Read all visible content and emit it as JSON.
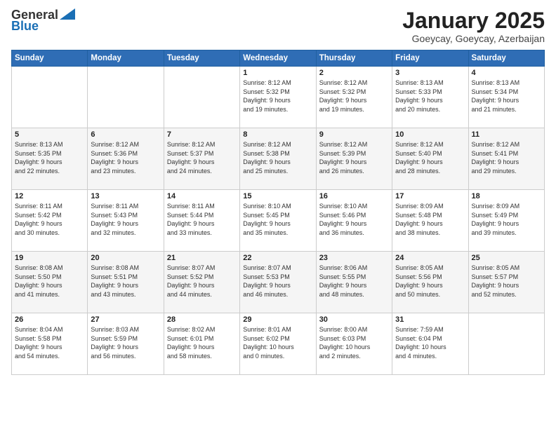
{
  "logo": {
    "general": "General",
    "blue": "Blue"
  },
  "header": {
    "month": "January 2025",
    "location": "Goeycay, Goeycay, Azerbaijan"
  },
  "weekdays": [
    "Sunday",
    "Monday",
    "Tuesday",
    "Wednesday",
    "Thursday",
    "Friday",
    "Saturday"
  ],
  "weeks": [
    [
      {
        "day": "",
        "info": ""
      },
      {
        "day": "",
        "info": ""
      },
      {
        "day": "",
        "info": ""
      },
      {
        "day": "1",
        "info": "Sunrise: 8:12 AM\nSunset: 5:32 PM\nDaylight: 9 hours\nand 19 minutes."
      },
      {
        "day": "2",
        "info": "Sunrise: 8:12 AM\nSunset: 5:32 PM\nDaylight: 9 hours\nand 19 minutes."
      },
      {
        "day": "3",
        "info": "Sunrise: 8:13 AM\nSunset: 5:33 PM\nDaylight: 9 hours\nand 20 minutes."
      },
      {
        "day": "4",
        "info": "Sunrise: 8:13 AM\nSunset: 5:34 PM\nDaylight: 9 hours\nand 21 minutes."
      }
    ],
    [
      {
        "day": "5",
        "info": "Sunrise: 8:13 AM\nSunset: 5:35 PM\nDaylight: 9 hours\nand 22 minutes."
      },
      {
        "day": "6",
        "info": "Sunrise: 8:12 AM\nSunset: 5:36 PM\nDaylight: 9 hours\nand 23 minutes."
      },
      {
        "day": "7",
        "info": "Sunrise: 8:12 AM\nSunset: 5:37 PM\nDaylight: 9 hours\nand 24 minutes."
      },
      {
        "day": "8",
        "info": "Sunrise: 8:12 AM\nSunset: 5:38 PM\nDaylight: 9 hours\nand 25 minutes."
      },
      {
        "day": "9",
        "info": "Sunrise: 8:12 AM\nSunset: 5:39 PM\nDaylight: 9 hours\nand 26 minutes."
      },
      {
        "day": "10",
        "info": "Sunrise: 8:12 AM\nSunset: 5:40 PM\nDaylight: 9 hours\nand 28 minutes."
      },
      {
        "day": "11",
        "info": "Sunrise: 8:12 AM\nSunset: 5:41 PM\nDaylight: 9 hours\nand 29 minutes."
      }
    ],
    [
      {
        "day": "12",
        "info": "Sunrise: 8:11 AM\nSunset: 5:42 PM\nDaylight: 9 hours\nand 30 minutes."
      },
      {
        "day": "13",
        "info": "Sunrise: 8:11 AM\nSunset: 5:43 PM\nDaylight: 9 hours\nand 32 minutes."
      },
      {
        "day": "14",
        "info": "Sunrise: 8:11 AM\nSunset: 5:44 PM\nDaylight: 9 hours\nand 33 minutes."
      },
      {
        "day": "15",
        "info": "Sunrise: 8:10 AM\nSunset: 5:45 PM\nDaylight: 9 hours\nand 35 minutes."
      },
      {
        "day": "16",
        "info": "Sunrise: 8:10 AM\nSunset: 5:46 PM\nDaylight: 9 hours\nand 36 minutes."
      },
      {
        "day": "17",
        "info": "Sunrise: 8:09 AM\nSunset: 5:48 PM\nDaylight: 9 hours\nand 38 minutes."
      },
      {
        "day": "18",
        "info": "Sunrise: 8:09 AM\nSunset: 5:49 PM\nDaylight: 9 hours\nand 39 minutes."
      }
    ],
    [
      {
        "day": "19",
        "info": "Sunrise: 8:08 AM\nSunset: 5:50 PM\nDaylight: 9 hours\nand 41 minutes."
      },
      {
        "day": "20",
        "info": "Sunrise: 8:08 AM\nSunset: 5:51 PM\nDaylight: 9 hours\nand 43 minutes."
      },
      {
        "day": "21",
        "info": "Sunrise: 8:07 AM\nSunset: 5:52 PM\nDaylight: 9 hours\nand 44 minutes."
      },
      {
        "day": "22",
        "info": "Sunrise: 8:07 AM\nSunset: 5:53 PM\nDaylight: 9 hours\nand 46 minutes."
      },
      {
        "day": "23",
        "info": "Sunrise: 8:06 AM\nSunset: 5:55 PM\nDaylight: 9 hours\nand 48 minutes."
      },
      {
        "day": "24",
        "info": "Sunrise: 8:05 AM\nSunset: 5:56 PM\nDaylight: 9 hours\nand 50 minutes."
      },
      {
        "day": "25",
        "info": "Sunrise: 8:05 AM\nSunset: 5:57 PM\nDaylight: 9 hours\nand 52 minutes."
      }
    ],
    [
      {
        "day": "26",
        "info": "Sunrise: 8:04 AM\nSunset: 5:58 PM\nDaylight: 9 hours\nand 54 minutes."
      },
      {
        "day": "27",
        "info": "Sunrise: 8:03 AM\nSunset: 5:59 PM\nDaylight: 9 hours\nand 56 minutes."
      },
      {
        "day": "28",
        "info": "Sunrise: 8:02 AM\nSunset: 6:01 PM\nDaylight: 9 hours\nand 58 minutes."
      },
      {
        "day": "29",
        "info": "Sunrise: 8:01 AM\nSunset: 6:02 PM\nDaylight: 10 hours\nand 0 minutes."
      },
      {
        "day": "30",
        "info": "Sunrise: 8:00 AM\nSunset: 6:03 PM\nDaylight: 10 hours\nand 2 minutes."
      },
      {
        "day": "31",
        "info": "Sunrise: 7:59 AM\nSunset: 6:04 PM\nDaylight: 10 hours\nand 4 minutes."
      },
      {
        "day": "",
        "info": ""
      }
    ]
  ]
}
